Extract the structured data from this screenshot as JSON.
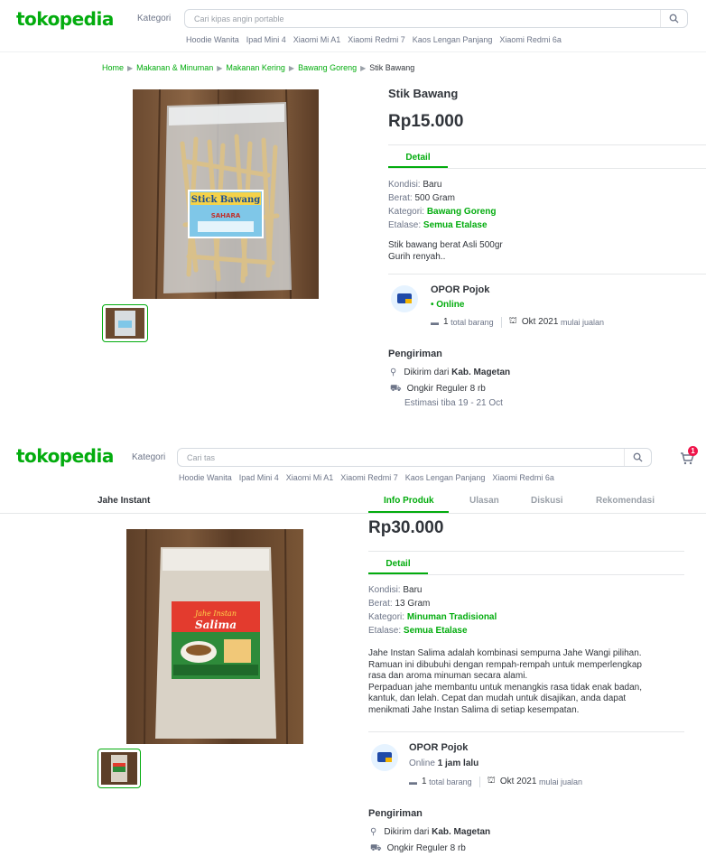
{
  "top": {
    "header": {
      "logo": "tokopedia",
      "kategori": "Kategori",
      "search_placeholder": "Cari kipas angin portable",
      "chips": [
        "Hoodie Wanita",
        "Ipad Mini 4",
        "Xiaomi Mi A1",
        "Xiaomi Redmi 7",
        "Kaos Lengan Panjang",
        "Xiaomi Redmi 6a"
      ]
    },
    "breadcrumb": [
      "Home",
      "Makanan & Minuman",
      "Makanan Kering",
      "Bawang Goreng",
      "Stik Bawang"
    ],
    "product": {
      "title": "Stik Bawang",
      "price": "Rp15.000",
      "tab": "Detail",
      "kondisi_label": "Kondisi:",
      "kondisi": "Baru",
      "berat_label": "Berat:",
      "berat": "500 Gram",
      "kategori_label": "Kategori:",
      "kategori": "Bawang Goreng",
      "etalase_label": "Etalase:",
      "etalase": "Semua Etalase",
      "desc1": "Stik bawang berat Asli 500gr",
      "desc2": "Gurih renyah..",
      "pkg_label_1": "Stick Bawang",
      "pkg_label_2": "SAHARA"
    },
    "shop": {
      "name": "OPOR Pojok",
      "status": "• Online",
      "total": "1",
      "total_label": "total barang",
      "since": "Okt 2021",
      "since_label": "mulai jualan"
    },
    "shipping": {
      "title": "Pengiriman",
      "from_label": "Dikirim dari",
      "from": "Kab. Magetan",
      "ongkir": "Ongkir Reguler 8 rb",
      "estimasi": "Estimasi tiba 19 - 21 Oct"
    }
  },
  "bottom": {
    "header": {
      "logo": "tokopedia",
      "kategori": "Kategori",
      "search_placeholder": "Cari tas",
      "cart_badge": "1",
      "chips": [
        "Hoodie Wanita",
        "Ipad Mini 4",
        "Xiaomi Mi A1",
        "Xiaomi Redmi 7",
        "Kaos Lengan Panjang",
        "Xiaomi Redmi 6a"
      ]
    },
    "sticky_title": "Jahe Instant",
    "nav_tabs": [
      "Info Produk",
      "Ulasan",
      "Diskusi",
      "Rekomendasi"
    ],
    "product": {
      "price": "Rp30.000",
      "tab": "Detail",
      "kondisi_label": "Kondisi:",
      "kondisi": "Baru",
      "berat_label": "Berat:",
      "berat": "13 Gram",
      "kategori_label": "Kategori:",
      "kategori": "Minuman Tradisional",
      "etalase_label": "Etalase:",
      "etalase": "Semua Etalase",
      "desc": [
        "Jahe Instan Salima adalah kombinasi sempurna Jahe Wangi pilihan.",
        "Ramuan ini dibubuhi dengan rempah-rempah untuk memperlengkap",
        "rasa dan aroma minuman secara alami.",
        "Perpaduan jahe membantu untuk menangkis rasa tidak enak badan,",
        "kantuk, dan lelah. Cepat dan mudah untuk disajikan, anda dapat",
        "menikmati Jahe Instan Salima di setiap kesempatan."
      ],
      "pkg_label_1": "Jahe Instan",
      "pkg_label_2": "Salima"
    },
    "shop": {
      "name": "OPOR Pojok",
      "status_prefix": "Online",
      "status_time": "1 jam lalu",
      "total": "1",
      "total_label": "total barang",
      "since": "Okt 2021",
      "since_label": "mulai jualan"
    },
    "shipping": {
      "title": "Pengiriman",
      "from_label": "Dikirim dari",
      "from": "Kab. Magetan",
      "ongkir": "Ongkir Reguler 8 rb"
    }
  },
  "colors": {
    "brand": "#03ac0e",
    "text": "#31353b",
    "muted": "#6d7588",
    "badge": "#ef144a"
  }
}
